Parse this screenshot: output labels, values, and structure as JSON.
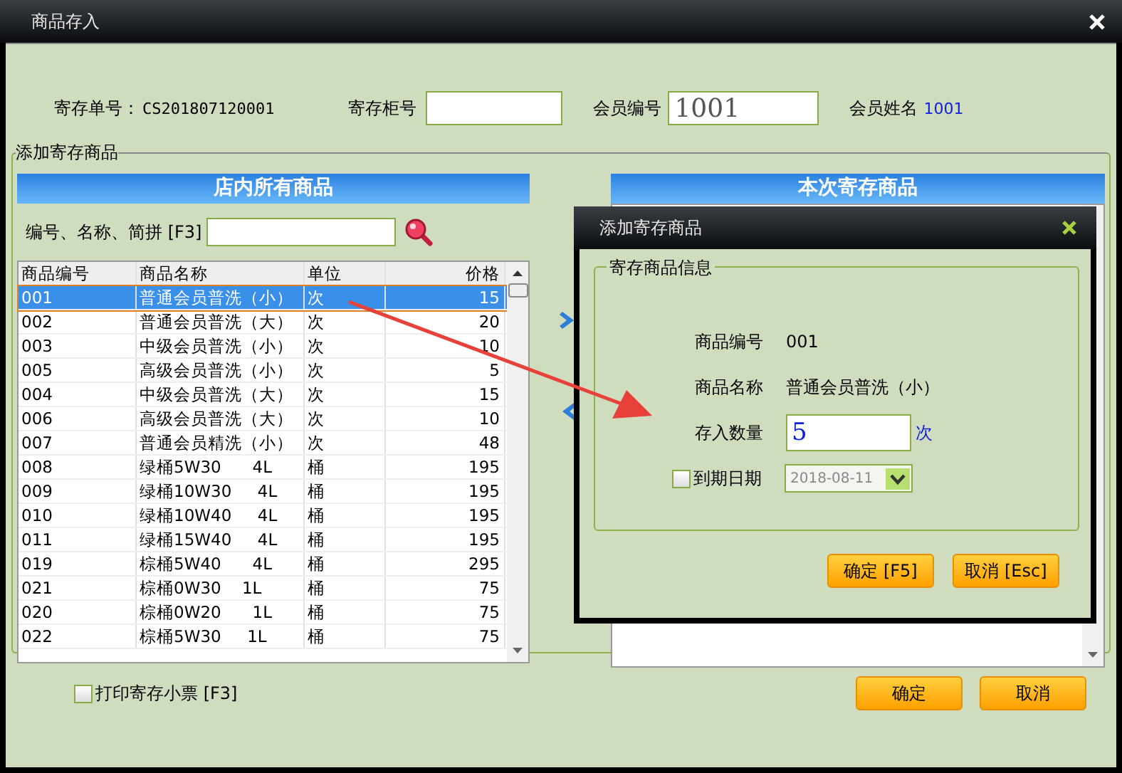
{
  "window": {
    "title": "商品存入"
  },
  "header": {
    "order_label": "寄存单号：",
    "order_no": "CS201807120001",
    "locker_label": "寄存柜号",
    "member_no_label": "会员编号",
    "member_no": "1001",
    "member_name_label": "会员姓名",
    "member_name": "1001"
  },
  "group_title": "添加寄存商品",
  "left": {
    "title": "店内所有商品",
    "search_label": "编号、名称、简拼 [F3]",
    "columns": [
      "商品编号",
      "商品名称",
      "单位",
      "价格"
    ],
    "rows": [
      {
        "cells": [
          "001",
          "普通会员普洗（小）",
          "次",
          "15"
        ],
        "selected": true
      },
      {
        "cells": [
          "002",
          "普通会员普洗（大）",
          "次",
          "20"
        ],
        "selected": false
      },
      {
        "cells": [
          "003",
          "中级会员普洗（小）",
          "次",
          "10"
        ],
        "selected": false
      },
      {
        "cells": [
          "005",
          "高级会员普洗（小）",
          "次",
          "5"
        ],
        "selected": false
      },
      {
        "cells": [
          "004",
          "中级会员普洗（大）",
          "次",
          "15"
        ],
        "selected": false
      },
      {
        "cells": [
          "006",
          "高级会员普洗（大）",
          "次",
          "10"
        ],
        "selected": false
      },
      {
        "cells": [
          "007",
          "普通会员精洗（小）",
          "次",
          "48"
        ],
        "selected": false
      },
      {
        "cells": [
          "008",
          "绿桶5W30      4L",
          "桶",
          "195"
        ],
        "selected": false
      },
      {
        "cells": [
          "009",
          "绿桶10W30     4L",
          "桶",
          "195"
        ],
        "selected": false
      },
      {
        "cells": [
          "010",
          "绿桶10W40     4L",
          "桶",
          "195"
        ],
        "selected": false
      },
      {
        "cells": [
          "011",
          "绿桶15W40     4L",
          "桶",
          "195"
        ],
        "selected": false
      },
      {
        "cells": [
          "019",
          "棕桶5W40      4L",
          "桶",
          "295"
        ],
        "selected": false
      },
      {
        "cells": [
          "021",
          "棕桶0W30    1L",
          "桶",
          "75"
        ],
        "selected": false
      },
      {
        "cells": [
          "020",
          "棕桶0W20      1L",
          "桶",
          "75"
        ],
        "selected": false
      },
      {
        "cells": [
          "022",
          "棕桶5W30     1L",
          "桶",
          "75"
        ],
        "selected": false
      }
    ]
  },
  "right": {
    "title": "本次寄存商品"
  },
  "print_option": {
    "label": "打印寄存小票 [F3]",
    "checked": false
  },
  "buttons": [
    "确定",
    "取消"
  ],
  "dialog": {
    "title": "添加寄存商品",
    "group_title": "寄存商品信息",
    "fields": [
      {
        "label": "商品编号",
        "value": "001"
      },
      {
        "label": "商品名称",
        "value": "普通会员普洗（小）"
      }
    ],
    "quantity": {
      "label": "存入数量",
      "value": "5",
      "unit": "次"
    },
    "expiry": {
      "label": "到期日期",
      "checked": false,
      "value": "2018-08-11"
    },
    "buttons": [
      "确定 [F5]",
      "取消 [Esc]"
    ]
  }
}
